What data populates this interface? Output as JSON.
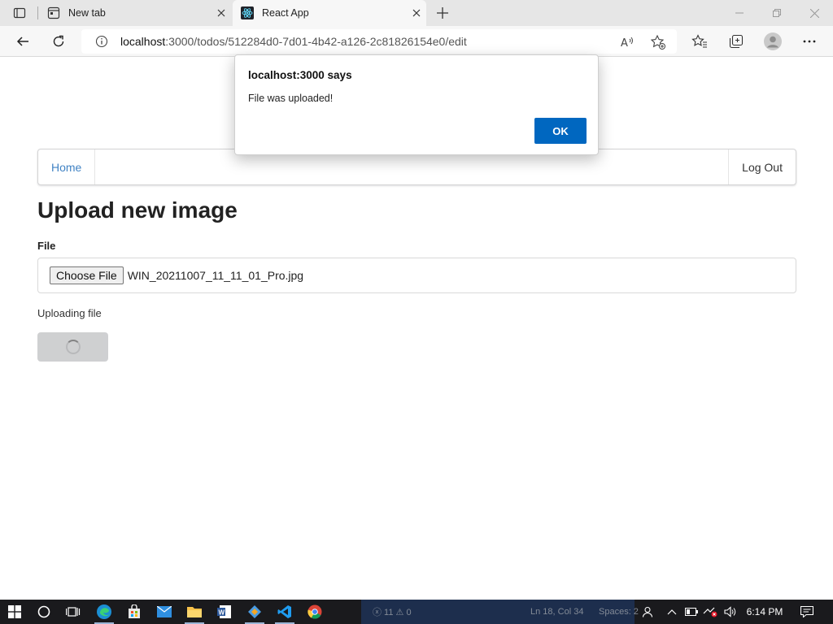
{
  "browser": {
    "tabs": [
      {
        "title": "New tab",
        "favicon": "new-tab-page-icon"
      },
      {
        "title": "React App",
        "favicon": "react-logo-icon",
        "active": true
      }
    ],
    "url_host": "localhost",
    "url_path": ":3000/todos/512284d0-7d01-4b42-a126-2c81826154e0/edit"
  },
  "nav": {
    "home_label": "Home",
    "logout_label": "Log Out"
  },
  "page": {
    "title": "Upload new image",
    "file_label": "File",
    "choose_file_label": "Choose File",
    "file_name": "WIN_20211007_11_11_01_Pro.jpg",
    "status_text": "Uploading file"
  },
  "dialog": {
    "title": "localhost:3000 says",
    "message": "File was uploaded!",
    "ok_label": "OK"
  },
  "taskbar": {
    "status_errors": "ⓧ 11 ⚠ 0",
    "status_position": "Ln 18, Col 34",
    "status_spaces": "Spaces: 2",
    "clock": "6:14 PM"
  },
  "colors": {
    "accent": "#0067c0",
    "link": "#4183c4",
    "taskbar": "#1a1a1d"
  }
}
